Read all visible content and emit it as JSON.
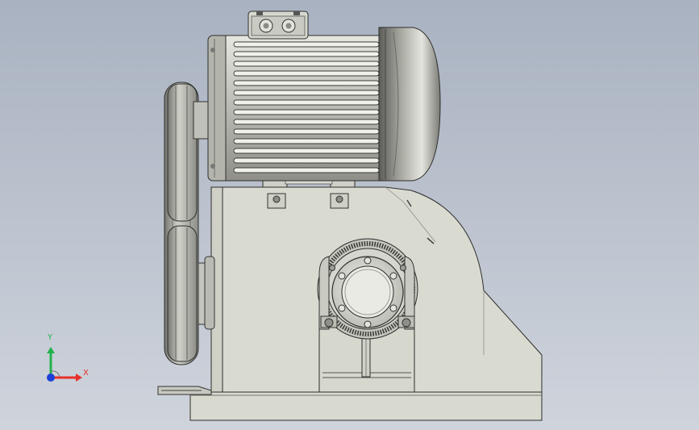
{
  "viewport": {
    "background_top": "#a9b2c1",
    "background_bottom": "#cfd4dc",
    "model": {
      "motor": "electric-motor",
      "pulleys": "belt-drive-pulleys",
      "gearbox": "worm-gear-reducer",
      "base": "base-frame"
    }
  },
  "triad": {
    "x_label": "X",
    "y_label": "Y",
    "x_color": "#e8302a",
    "y_color": "#22b24c",
    "z_color": "#1e3fd8"
  }
}
